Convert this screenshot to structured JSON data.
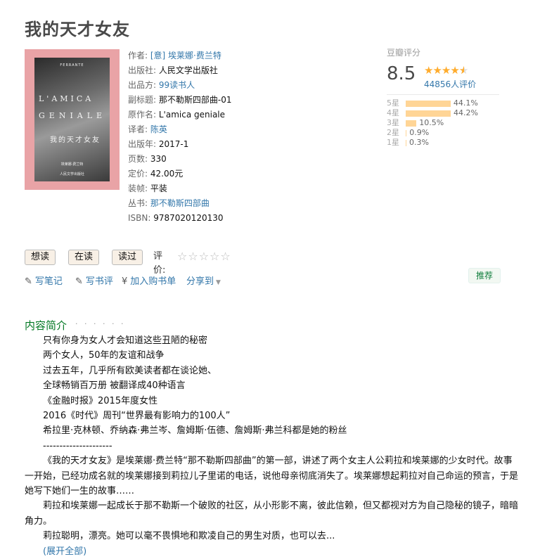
{
  "book": {
    "title": "我的天才女友"
  },
  "cover": {
    "top_text": "FERRANTE",
    "title_line1": "L'AMICA",
    "title_line2": "GENIALE",
    "cn_title": "我的天才女友",
    "author_line": "埃莱娜·费兰特",
    "publisher_line": "人民文学出版社"
  },
  "info": {
    "author_label": "作者:",
    "author_value": "[意] 埃莱娜·费兰特",
    "publisher_label": "出版社:",
    "publisher_value": "人民文学出版社",
    "producer_label": "出品方:",
    "producer_value": "99读书人",
    "subtitle_label": "副标题:",
    "subtitle_value": "那不勒斯四部曲-01",
    "original_label": "原作名:",
    "original_value": "L'amica geniale",
    "translator_label": "译者:",
    "translator_value": "陈英",
    "year_label": "出版年:",
    "year_value": "2017-1",
    "pages_label": "页数:",
    "pages_value": "330",
    "price_label": "定价:",
    "price_value": "42.00元",
    "binding_label": "装帧:",
    "binding_value": "平装",
    "series_label": "丛书:",
    "series_value": "那不勒斯四部曲",
    "isbn_label": "ISBN:",
    "isbn_value": "9787020120130"
  },
  "rating": {
    "label": "豆瓣评分",
    "score": "8.5",
    "votes": "44856人评价",
    "star_color": "#ffac2d",
    "bar_color": "#ffd596",
    "breakdown": [
      {
        "label": "5星",
        "pct": "44.1%",
        "value": 44.1
      },
      {
        "label": "4星",
        "pct": "44.2%",
        "value": 44.2
      },
      {
        "label": "3星",
        "pct": "10.5%",
        "value": 10.5
      },
      {
        "label": "2星",
        "pct": "0.9%",
        "value": 0.9
      },
      {
        "label": "1星",
        "pct": "0.3%",
        "value": 0.3
      }
    ]
  },
  "actions": {
    "want_read": "想读",
    "reading": "在读",
    "read": "读过",
    "rate_label": "评价:",
    "write_note": "写笔记",
    "write_review": "写书评",
    "add_cart": "加入购书单",
    "share": "分享到",
    "recommend": "推荐",
    "icons": {
      "write_note": "pencil-icon",
      "write_review": "pencil-icon",
      "add_cart": "yen-icon",
      "share": "chevron-down-icon"
    }
  },
  "summary": {
    "title": "内容简介",
    "dots": "· · · · · ·",
    "lines": [
      "只有你身为女人才会知道这些丑陋的秘密",
      "两个女人，50年的友谊和战争",
      "过去五年，几乎所有欧美读者都在谈论她、",
      "全球畅销百万册 被翻译成40种语言",
      "《金融时报》2015年度女性",
      "2016《时代》周刊“世界最有影响力的100人”",
      "希拉里·克林顿、乔纳森·弗兰岑、詹姆斯·伍德、詹姆斯·弗兰科都是她的粉丝",
      "---------------------"
    ],
    "paragraphs": [
      "《我的天才女友》是埃莱娜·费兰特“那不勒斯四部曲”的第一部，讲述了两个女主人公莉拉和埃莱娜的少女时代。故事一开始，已经功成名就的埃莱娜接到莉拉儿子里诺的电话，说他母亲彻底消失了。埃莱娜想起莉拉对自己命运的预言，于是她写下她们一生的故事……",
      "莉拉和埃莱娜一起成长于那不勒斯一个破败的社区，从小形影不离，彼此信赖，但又都视对方为自己隐秘的镜子，暗暗角力。",
      "莉拉聪明，漂亮。她可以毫不畏惧地和欺凌自己的男生对质，也可以去..."
    ],
    "expand": "(展开全部)"
  }
}
